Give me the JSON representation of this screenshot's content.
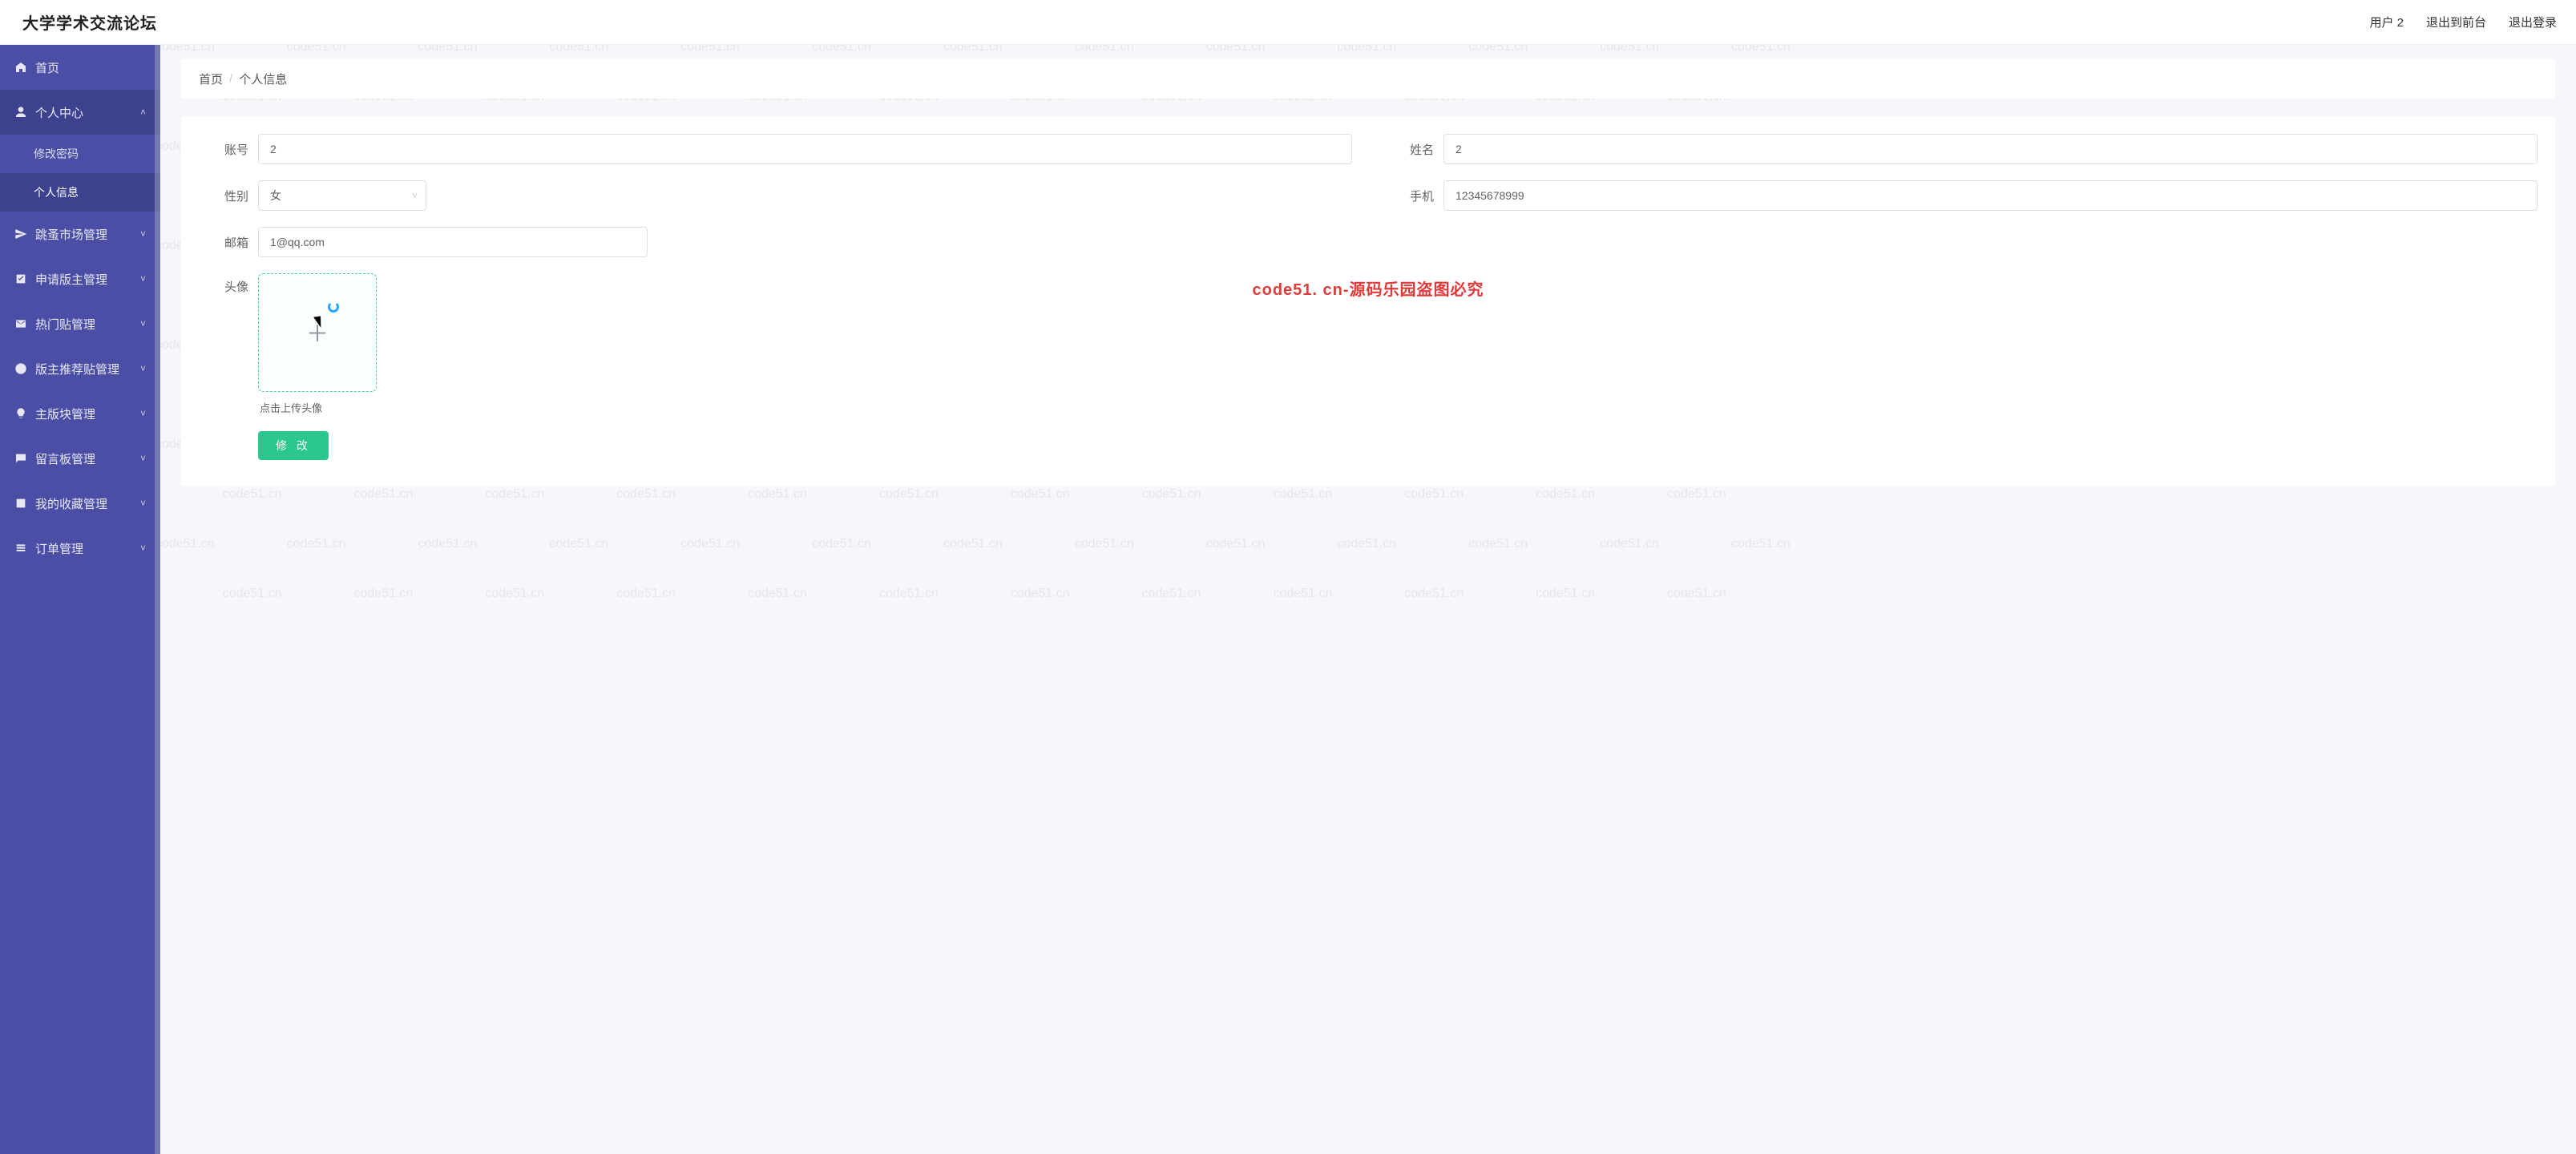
{
  "app_title": "大学学术交流论坛",
  "topbar": {
    "user_label": "用户 2",
    "exit_front_label": "退出到前台",
    "logout_label": "退出登录"
  },
  "sidebar": {
    "items": [
      {
        "icon": "home",
        "label": "首页",
        "type": "link"
      },
      {
        "icon": "user",
        "label": "个人中心",
        "type": "group",
        "expanded": true,
        "children": [
          {
            "label": "修改密码",
            "active": false
          },
          {
            "label": "个人信息",
            "active": true
          }
        ]
      },
      {
        "icon": "send",
        "label": "跳蚤市场管理",
        "type": "group",
        "expanded": false
      },
      {
        "icon": "check-square",
        "label": "申请版主管理",
        "type": "group",
        "expanded": false
      },
      {
        "icon": "mail",
        "label": "热门贴管理",
        "type": "group",
        "expanded": false
      },
      {
        "icon": "clock",
        "label": "版主推荐贴管理",
        "type": "group",
        "expanded": false
      },
      {
        "icon": "bulb",
        "label": "主版块管理",
        "type": "group",
        "expanded": false
      },
      {
        "icon": "message",
        "label": "留言板管理",
        "type": "group",
        "expanded": false
      },
      {
        "icon": "image",
        "label": "我的收藏管理",
        "type": "group",
        "expanded": false
      },
      {
        "icon": "list",
        "label": "订单管理",
        "type": "group",
        "expanded": false
      }
    ]
  },
  "breadcrumb": {
    "home": "首页",
    "current": "个人信息"
  },
  "form": {
    "account_label": "账号",
    "account_value": "2",
    "name_label": "姓名",
    "name_value": "2",
    "gender_label": "性别",
    "gender_value": "女",
    "phone_label": "手机",
    "phone_value": "12345678999",
    "email_label": "邮箱",
    "email_value": "1@qq.com",
    "avatar_label": "头像",
    "upload_hint": "点击上传头像",
    "submit_label": "修 改"
  },
  "watermark": {
    "text": "code51.cn",
    "central": "code51. cn-源码乐园盗图必究"
  }
}
